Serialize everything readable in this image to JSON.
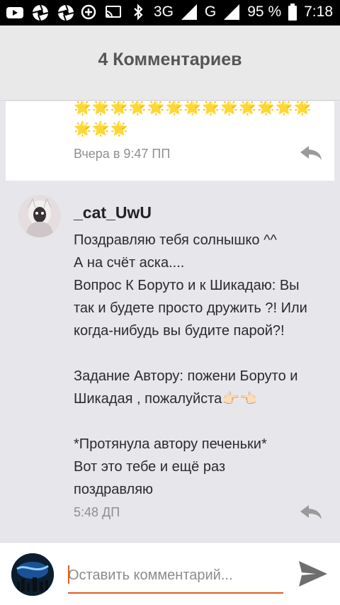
{
  "status_bar": {
    "left_icons": [
      "youtube-icon",
      "aperture-icon",
      "aperture-icon",
      "data-saver-icon",
      "cast-icon",
      "bluetooth-icon"
    ],
    "network": "3G",
    "network_sup": "3G",
    "carrier_letter": "G",
    "battery": "95 %",
    "time": "7:18"
  },
  "header": {
    "title": "4 Комментариев"
  },
  "comments": [
    {
      "stars_line1": "🌟🌟🌟🌟🌟🌟🌟🌟🌟🌟🌟🌟🌟",
      "stars_line2": "🌟🌟🌟",
      "time": "Вчера в 9:47 ПП"
    },
    {
      "username": "_cat_UwU",
      "lines": [
        "Поздравляю тебя солнышко ^^",
        "А на счёт аска....",
        "Вопрос К Боруто и к Шикадаю: Вы",
        "так и будете просто дружить ?! Или",
        "когда-нибудь вы будите парой?!",
        "",
        "Задание Автору: пожени Боруто и",
        "Шикадая , пожалуйста👉🏻👈🏻",
        "",
        "*Протянула автору печеньки*",
        "Вот это тебе и ещё раз",
        "поздравляю"
      ],
      "time": "5:48 ДП"
    }
  ],
  "input": {
    "placeholder": "Оставить комментарий...",
    "value": ""
  },
  "colors": {
    "accent": "#e05b1e",
    "header_bg": "#e9e9e9",
    "list_bg": "#e7e6eb"
  }
}
